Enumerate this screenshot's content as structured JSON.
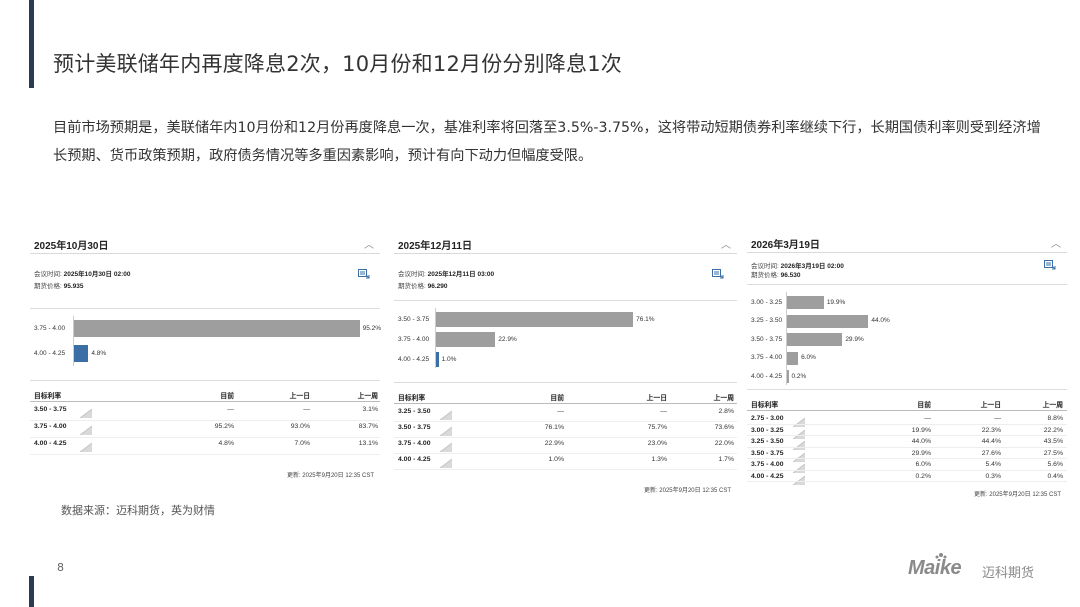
{
  "slide": {
    "title": "预计美联储年内再度降息2次，10月份和12月份分别降息1次",
    "body": "目前市场预期是，美联储年内10月份和12月份再度降息一次，基准利率将回落至3.5%-3.75%，这将带动短期债券利率继续下行，长期国债利率则受到经济增长预期、货币政策预期，政府债务情况等多重因素影响，预计有向下动力但幅度受限。",
    "source": "数据来源：迈科期货，英为财情",
    "page_number": "8",
    "logo_latin": "Maike",
    "logo_cn": "迈科期货"
  },
  "labels": {
    "meeting_time": "会议时间:",
    "futures_price": "期货价格:",
    "target_rate": "目标利率",
    "now": "目前",
    "prev_day": "上一日",
    "prev_week": "上一周"
  },
  "colors": {
    "accent": "#2e3a55",
    "bar": "#9e9e9e",
    "bar_highlight": "#3a6ea5"
  },
  "chart_data": [
    {
      "type": "bar",
      "title": "2025年10月30日",
      "meeting_time": "2025年10月30日 02:00",
      "futures_price": "95.935",
      "categories": [
        "3.75 - 4.00",
        "4.00 - 4.25"
      ],
      "values": [
        95.2,
        4.8
      ],
      "value_labels": [
        "95.2%",
        "4.8%"
      ],
      "highlight_index": 1,
      "table": {
        "rows": [
          {
            "range": "3.50 - 3.75",
            "now": "—",
            "prev_day": "—",
            "prev_week": "3.1%"
          },
          {
            "range": "3.75 - 4.00",
            "now": "95.2%",
            "prev_day": "93.0%",
            "prev_week": "83.7%"
          },
          {
            "range": "4.00 - 4.25",
            "now": "4.8%",
            "prev_day": "7.0%",
            "prev_week": "13.1%"
          }
        ]
      },
      "updated": "更新: 2025年9月20日 12:35 CST"
    },
    {
      "type": "bar",
      "title": "2025年12月11日",
      "meeting_time": "2025年12月11日 03:00",
      "futures_price": "96.290",
      "categories": [
        "3.50 - 3.75",
        "3.75 - 4.00",
        "4.00 - 4.25"
      ],
      "values": [
        76.1,
        22.9,
        1.0
      ],
      "value_labels": [
        "76.1%",
        "22.9%",
        "1.0%"
      ],
      "highlight_index": 2,
      "table": {
        "rows": [
          {
            "range": "3.25 - 3.50",
            "now": "—",
            "prev_day": "—",
            "prev_week": "2.8%"
          },
          {
            "range": "3.50 - 3.75",
            "now": "76.1%",
            "prev_day": "75.7%",
            "prev_week": "73.6%"
          },
          {
            "range": "3.75 - 4.00",
            "now": "22.9%",
            "prev_day": "23.0%",
            "prev_week": "22.0%"
          },
          {
            "range": "4.00 - 4.25",
            "now": "1.0%",
            "prev_day": "1.3%",
            "prev_week": "1.7%"
          }
        ]
      },
      "updated": "更新: 2025年9月20日 12:35 CST"
    },
    {
      "type": "bar",
      "title": "2026年3月19日",
      "meeting_time": "2026年3月19日 02:00",
      "futures_price": "96.530",
      "categories": [
        "3.00 - 3.25",
        "3.25 - 3.50",
        "3.50 - 3.75",
        "3.75 - 4.00",
        "4.00 - 4.25"
      ],
      "values": [
        19.9,
        44.0,
        29.9,
        6.0,
        0.2
      ],
      "value_labels": [
        "19.9%",
        "44.0%",
        "29.9%",
        "6.0%",
        "0.2%"
      ],
      "highlight_index": -1,
      "table": {
        "rows": [
          {
            "range": "2.75 - 3.00",
            "now": "—",
            "prev_day": "—",
            "prev_week": "8.8%"
          },
          {
            "range": "3.00 - 3.25",
            "now": "19.9%",
            "prev_day": "22.3%",
            "prev_week": "22.2%"
          },
          {
            "range": "3.25 - 3.50",
            "now": "44.0%",
            "prev_day": "44.4%",
            "prev_week": "43.5%"
          },
          {
            "range": "3.50 - 3.75",
            "now": "29.9%",
            "prev_day": "27.6%",
            "prev_week": "27.5%"
          },
          {
            "range": "3.75 - 4.00",
            "now": "6.0%",
            "prev_day": "5.4%",
            "prev_week": "5.6%"
          },
          {
            "range": "4.00 - 4.25",
            "now": "0.2%",
            "prev_day": "0.3%",
            "prev_week": "0.4%"
          }
        ]
      },
      "updated": "更新: 2025年9月20日 12:35 CST"
    }
  ]
}
